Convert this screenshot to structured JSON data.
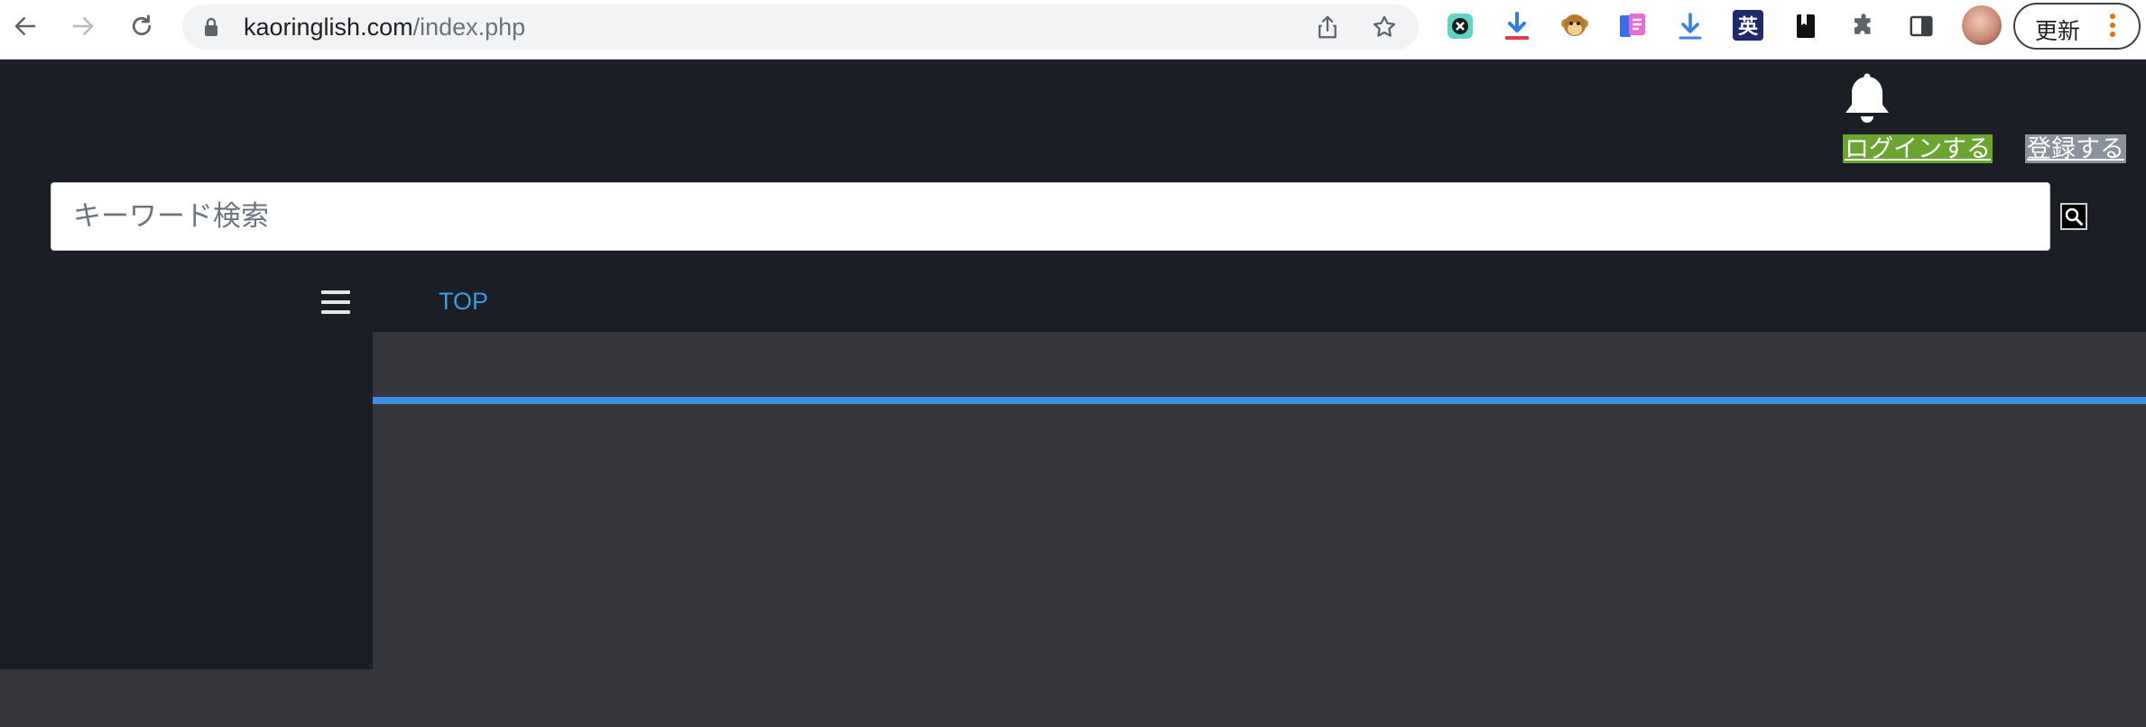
{
  "browser": {
    "url_host": "kaoringlish.com",
    "url_path": "/index.php",
    "update_label": "更新",
    "extensions": [
      "ublock-icon",
      "download-icon",
      "monkey-icon",
      "reader-icon",
      "download-arrow-icon",
      "eijiro-icon",
      "bookmark-icon",
      "puzzle-icon",
      "side-panel-icon"
    ],
    "extension_text": "英"
  },
  "header": {
    "login_label": "ログインする",
    "register_label": "登録する"
  },
  "search": {
    "placeholder": "キーワード検索"
  },
  "nav": {
    "top_label": "TOP"
  },
  "colors": {
    "dark_bg": "#1c1e26",
    "content_bg": "#35363b",
    "accent": "#3b8fe0",
    "login_bg": "#6aa532",
    "register_bg": "#8a929b",
    "link": "#3b9ae1"
  }
}
